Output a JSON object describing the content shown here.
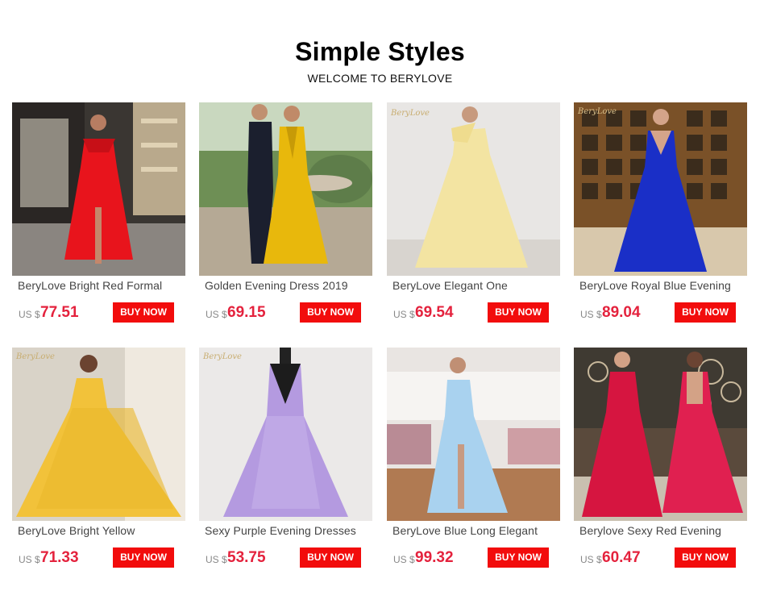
{
  "header": {
    "title": "Simple Styles",
    "subtitle": "WELCOME TO BERYLOVE"
  },
  "products": [
    {
      "name": "BeryLove Bright Red Formal",
      "currency": "US $",
      "price": "77.51",
      "button": "BUY NOW",
      "dress_color": "#e8141c"
    },
    {
      "name": "Golden Evening Dress 2019",
      "currency": "US $",
      "price": "69.15",
      "button": "BUY NOW",
      "dress_color": "#e8b80c"
    },
    {
      "name": "BeryLove Elegant One",
      "currency": "US $",
      "price": "69.54",
      "button": "BUY NOW",
      "dress_color": "#f3e4a2"
    },
    {
      "name": "BeryLove Royal Blue Evening",
      "currency": "US $",
      "price": "89.04",
      "button": "BUY NOW",
      "dress_color": "#1a2fc7"
    },
    {
      "name": "BeryLove Bright Yellow",
      "currency": "US $",
      "price": "71.33",
      "button": "BUY NOW",
      "dress_color": "#f2c23a"
    },
    {
      "name": "Sexy Purple Evening Dresses",
      "currency": "US $",
      "price": "53.75",
      "button": "BUY NOW",
      "dress_color": "#b49ae0"
    },
    {
      "name": "BeryLove Blue Long Elegant",
      "currency": "US $",
      "price": "99.32",
      "button": "BUY NOW",
      "dress_color": "#a9d2ef"
    },
    {
      "name": "Berylove Sexy Red Evening",
      "currency": "US $",
      "price": "60.47",
      "button": "BUY NOW",
      "dress_color": "#d61540"
    }
  ],
  "colors": {
    "price": "#e4223d",
    "button_bg": "#f20c0c",
    "button_text": "#ffffff"
  }
}
